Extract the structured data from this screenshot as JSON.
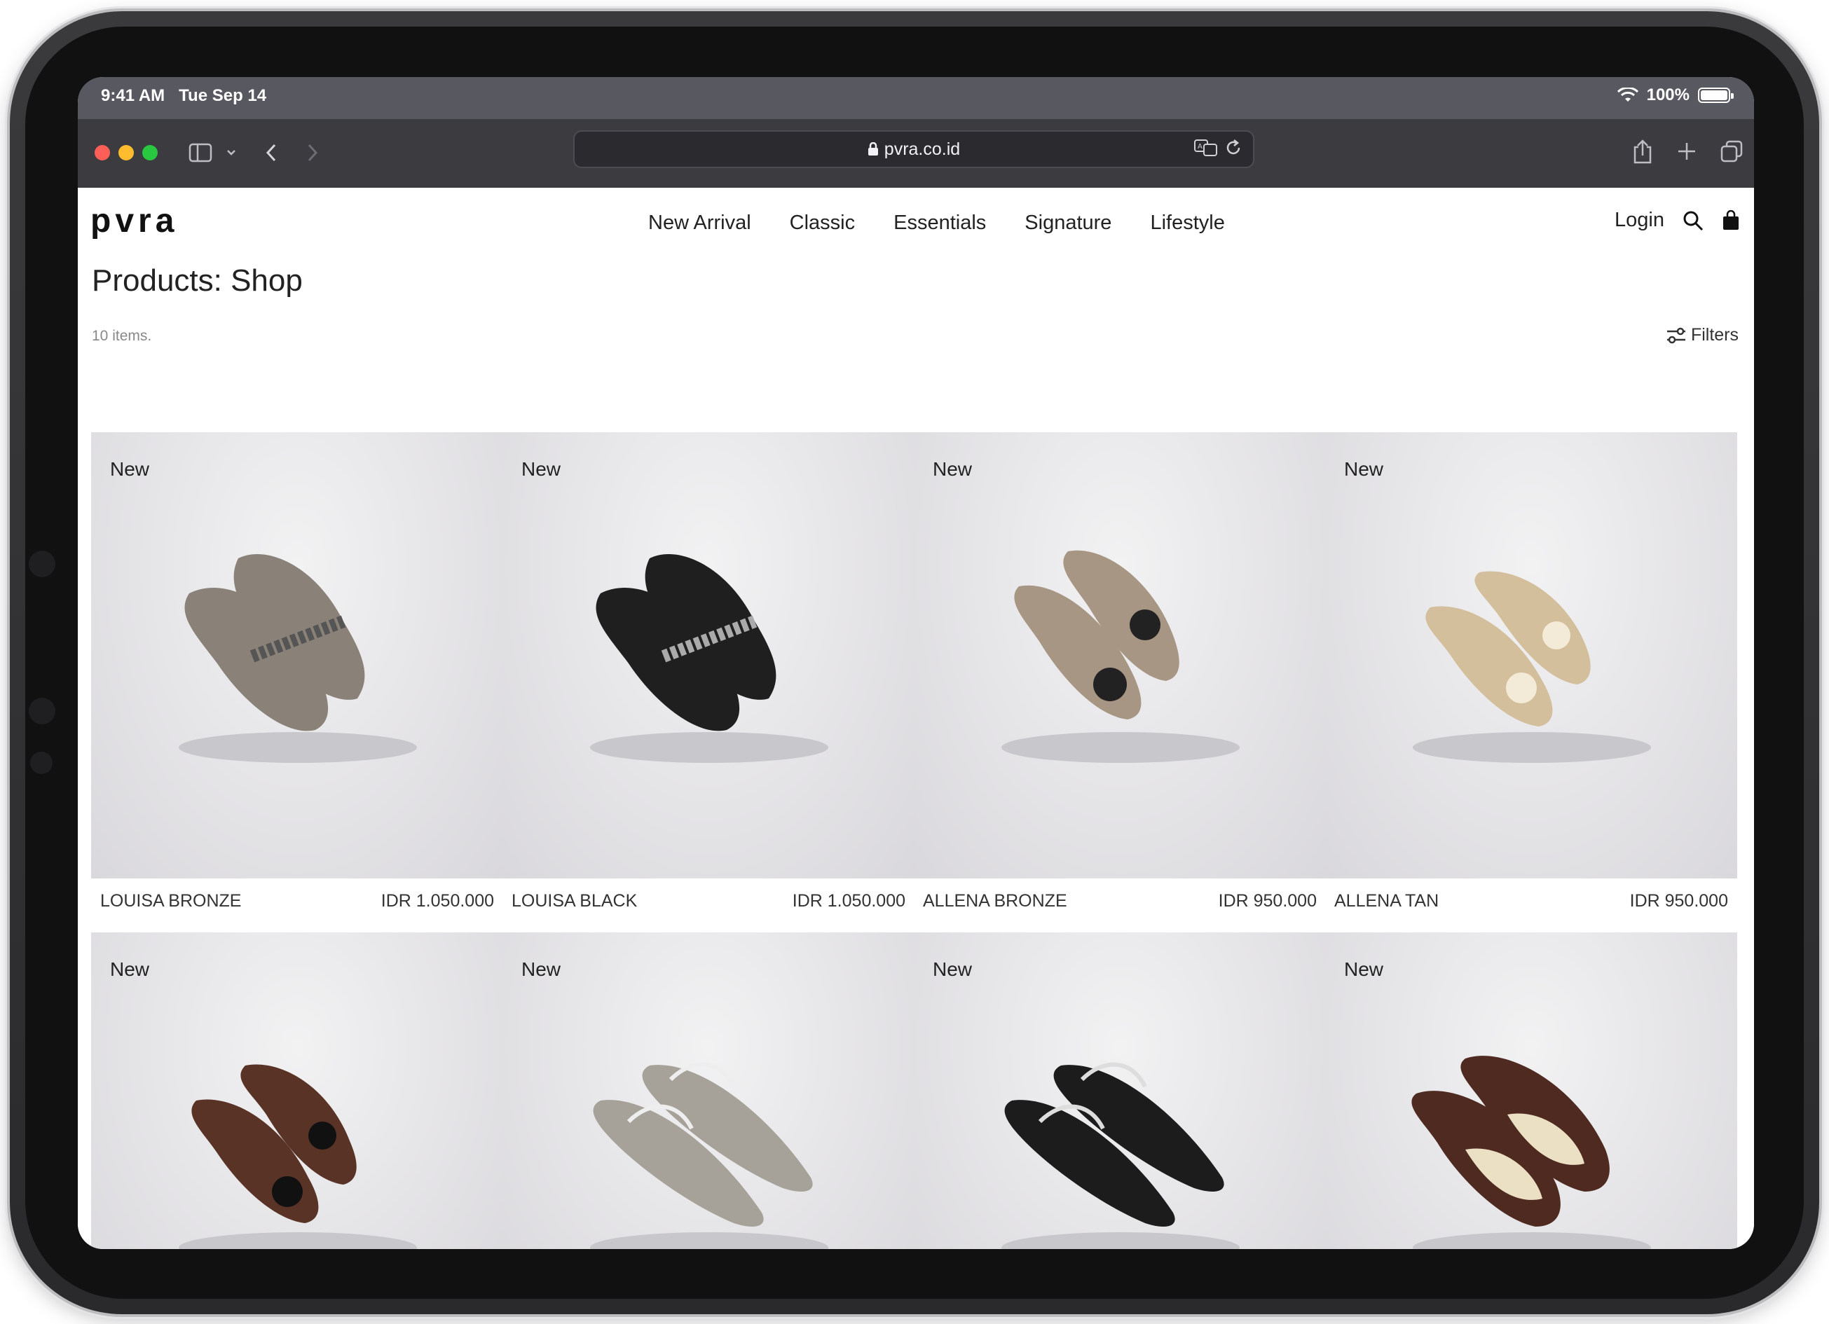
{
  "status": {
    "time": "9:41 AM",
    "date": "Tue Sep 14",
    "battery": "100%"
  },
  "browser": {
    "url": "pvra.co.id"
  },
  "site": {
    "logo": "pvra",
    "nav": [
      "New Arrival",
      "Classic",
      "Essentials",
      "Signature",
      "Lifestyle"
    ],
    "login": "Login"
  },
  "page": {
    "title": "Products: Shop",
    "count": "10 items.",
    "filters": "Filters"
  },
  "products": [
    {
      "badge": "New",
      "name": "LOUISA BRONZE",
      "price": "IDR 1.050.000",
      "color": "#8a8278"
    },
    {
      "badge": "New",
      "name": "LOUISA BLACK",
      "price": "IDR 1.050.000",
      "color": "#1f1f1f"
    },
    {
      "badge": "New",
      "name": "ALLENA BRONZE",
      "price": "IDR 950.000",
      "color": "#a79683"
    },
    {
      "badge": "New",
      "name": "ALLENA TAN",
      "price": "IDR 950.000",
      "color": "#d4bf9c"
    },
    {
      "badge": "New",
      "color": "#5a3327"
    },
    {
      "badge": "New",
      "color": "#a6a199"
    },
    {
      "badge": "New",
      "color": "#1c1c1c"
    },
    {
      "badge": "New",
      "color": "#4e2a20"
    }
  ]
}
